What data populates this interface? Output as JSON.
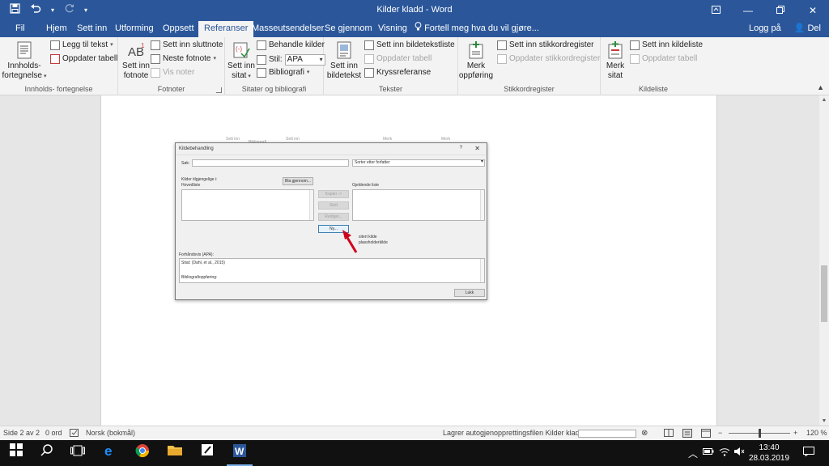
{
  "window": {
    "title": "Kilder kladd - Word"
  },
  "qat": {
    "save_icon": "save-icon",
    "undo_icon": "undo-icon",
    "redo_icon": "redo-icon"
  },
  "tabs": [
    "Fil",
    "Hjem",
    "Sett inn",
    "Utforming",
    "Oppsett",
    "Referanser",
    "Masseutsendelser",
    "Se gjennom",
    "Visning"
  ],
  "active_tab": "Referanser",
  "tellme": "Fortell meg hva du vil gjøre...",
  "account": {
    "login": "Logg på",
    "share": "Del"
  },
  "ribbon": {
    "toc": {
      "label": "Innholds-\nfortegnelse",
      "label1": "Innholds-",
      "label2": "fortegnelse",
      "add_text": "Legg til tekst",
      "update_table": "Oppdater tabell",
      "group": "Innholds- fortegnelse"
    },
    "footnotes": {
      "insert_footnote1": "Sett inn",
      "insert_footnote2": "fotnote",
      "insert_endnote": "Sett inn sluttnote",
      "next_footnote": "Neste fotnote",
      "show_notes": "Vis noter",
      "group": "Fotnoter"
    },
    "citations": {
      "insert_citation1": "Sett inn",
      "insert_citation2": "sitat",
      "manage_sources": "Behandle kilder",
      "style_label": "Stil:",
      "style_value": "APA",
      "bibliography": "Bibliografi",
      "group": "Sitater og bibliografi"
    },
    "captions": {
      "insert_caption1": "Sett inn",
      "insert_caption2": "bildetekst",
      "insert_table_of_figures": "Sett inn bildetekstliste",
      "update_table": "Oppdater tabell",
      "cross_reference": "Kryssreferanse",
      "group": "Tekster"
    },
    "index": {
      "mark_entry1": "Merk",
      "mark_entry2": "oppføring",
      "insert_index": "Sett inn stikkordregister",
      "update_index": "Oppdater stikkordregister",
      "group": "Stikkordregister"
    },
    "toa": {
      "mark_citation1": "Merk",
      "mark_citation2": "sitat",
      "insert_toa": "Sett inn kildeliste",
      "update_table": "Oppdater tabell",
      "group": "Kildeliste"
    }
  },
  "dialog": {
    "title": "Kildebehandling",
    "help": "?",
    "close": "✕",
    "search_label": "Søk:",
    "sort_value": "Sorter etter forfatter",
    "sources_available_label": "Kilder tilgjengelige i:",
    "master_list": "Hovedliste",
    "browse_button": "Bla gjennom...",
    "current_list_label": "Gjeldende liste",
    "copy_button": "Kopier ->",
    "delete_button": "Slett",
    "edit_button": "Rediger...",
    "new_button": "Ny...",
    "legend_cited": "sitert kilde",
    "legend_placeholder": "plassholderkilde",
    "preview_label": "Forhåndsvis (APA):",
    "preview_citation": "Sitat: (Dahl, et al., 2015)",
    "preview_bibliography": "Bibliografioppføring:",
    "close_button": "Lukk"
  },
  "ghost_ribbon_text": [
    "Sett inn",
    "Bibliografi",
    "Sett inn",
    "Merk",
    "Merk"
  ],
  "statusbar": {
    "page": "Side 2 av 2",
    "words": "0 ord",
    "language": "Norsk (bokmål)",
    "autosave": "Lagrer autogjenopprettingsfilen Kilder kladd:",
    "zoom": "120 %"
  },
  "taskbar": {
    "time": "13:40",
    "date": "28.03.2019"
  },
  "colors": {
    "word_blue": "#2b579a",
    "arrow_red": "#d0021b"
  }
}
